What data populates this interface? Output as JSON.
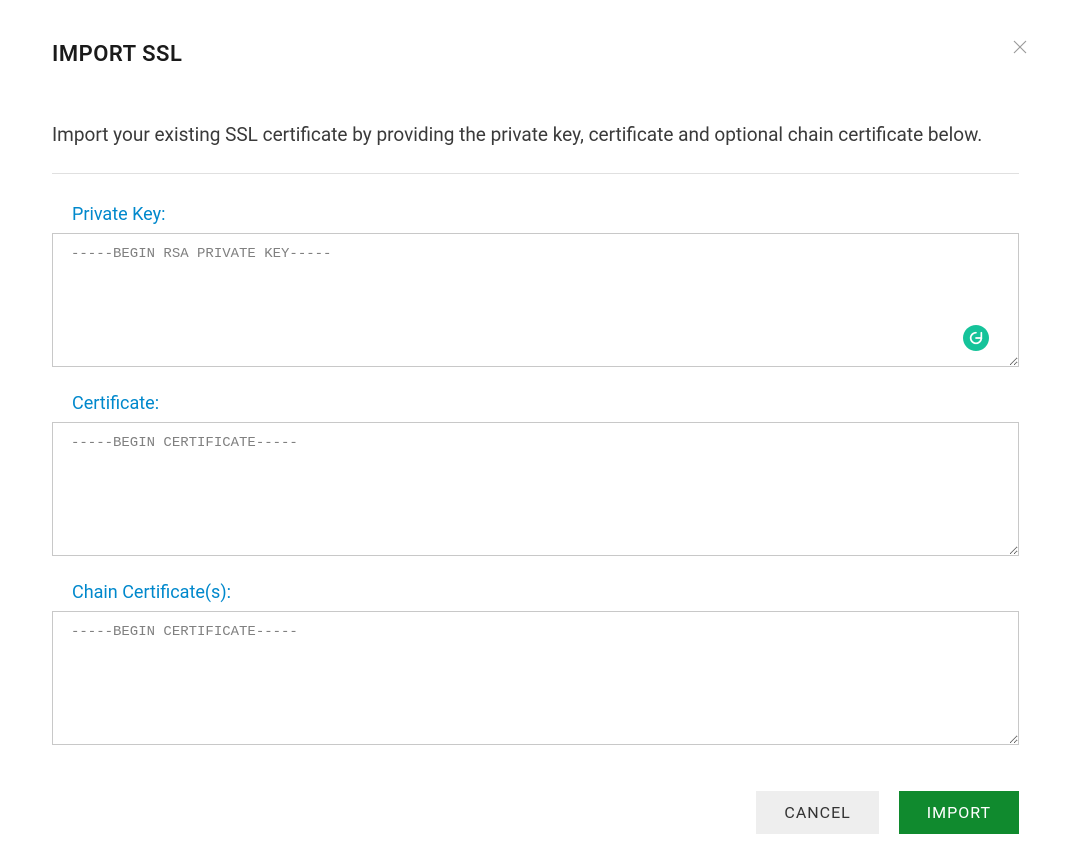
{
  "dialog": {
    "title": "IMPORT SSL",
    "description": "Import your existing SSL certificate by providing the private key, certificate and optional chain certificate below."
  },
  "fields": {
    "private_key": {
      "label": "Private Key:",
      "placeholder": "-----BEGIN RSA PRIVATE KEY-----",
      "value": ""
    },
    "certificate": {
      "label": "Certificate:",
      "placeholder": "-----BEGIN CERTIFICATE-----",
      "value": ""
    },
    "chain": {
      "label": "Chain Certificate(s):",
      "placeholder": "-----BEGIN CERTIFICATE-----",
      "value": ""
    }
  },
  "buttons": {
    "cancel": "CANCEL",
    "import": "IMPORT"
  }
}
